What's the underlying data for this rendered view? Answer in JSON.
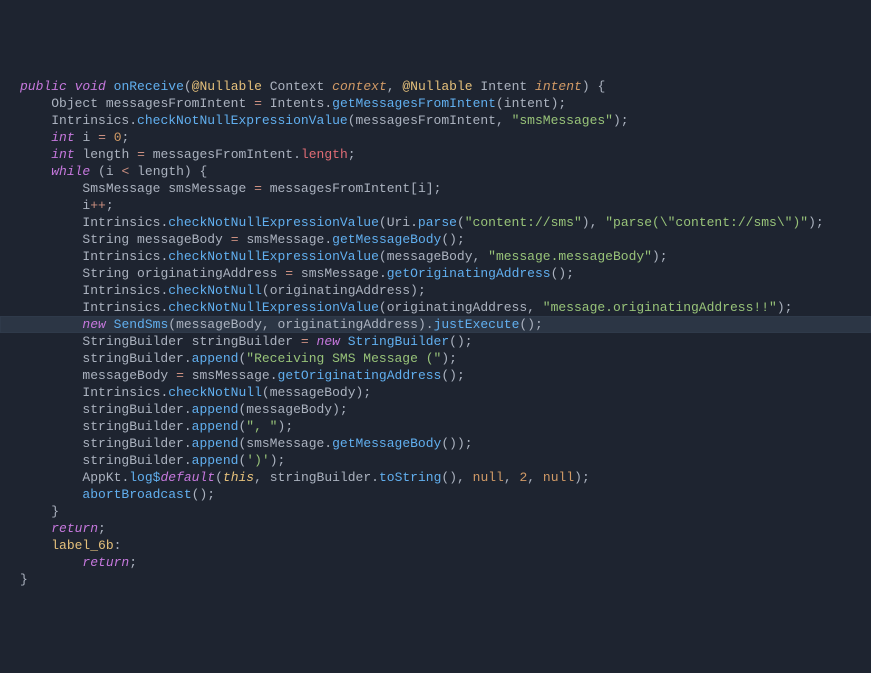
{
  "code": {
    "kw_public": "public",
    "kw_void": "void",
    "fn_onReceive": "onReceive",
    "an_Nullable1": "@Nullable",
    "type_Context": "Context",
    "param_context": "context",
    "an_Nullable2": "@Nullable",
    "type_Intent": "Intent",
    "param_intent": "intent",
    "brace_open": "{",
    "brace_close": "}",
    "paren_open": "(",
    "paren_close": ")",
    "semi": ";",
    "comma": ",",
    "dot": ".",
    "eq": "=",
    "plusplus": "++",
    "lt": "<",
    "lbracket": "[",
    "rbracket": "]",
    "type_Object": "Object",
    "var_messagesFromIntent": "messagesFromIntent",
    "type_Intents": "Intents",
    "fn_getMessagesFromIntent": "getMessagesFromIntent",
    "var_intent": "intent",
    "type_Intrinsics": "Intrinsics",
    "fn_checkNotNullExpressionValue": "checkNotNullExpressionValue",
    "str_smsMessages": "\"smsMessages\"",
    "kw_int": "int",
    "var_i": "i",
    "num_0": "0",
    "var_length": "length",
    "prop_length": "length",
    "kw_while": "while",
    "type_SmsMessage": "SmsMessage",
    "var_smsMessage": "smsMessage",
    "type_Uri": "Uri",
    "fn_parse": "parse",
    "str_contentSms": "\"content://sms\"",
    "str_parseContentSms": "\"parse(\\\"content://sms\\\")\"",
    "type_String": "String",
    "var_messageBody": "messageBody",
    "fn_getMessageBody": "getMessageBody",
    "str_messageMessageBody": "\"message.messageBody\"",
    "var_originatingAddress": "originatingAddress",
    "fn_getOriginatingAddress": "getOriginatingAddress",
    "fn_checkNotNull": "checkNotNull",
    "str_messageOriginatingAddress": "\"message.originatingAddress!!\"",
    "kw_new": "new",
    "type_SendSms": "SendSms",
    "fn_justExecute": "justExecute",
    "type_StringBuilder": "StringBuilder",
    "var_stringBuilder": "stringBuilder",
    "fn_append": "append",
    "str_receivingSmsMessage": "\"Receiving SMS Message (\"",
    "str_commaSpace": "\", \"",
    "str_closeParen": "')'",
    "type_AppKt": "AppKt",
    "fn_logDefault": "log$",
    "fn_default": "default",
    "kw_this": "this",
    "fn_toString": "toString",
    "kw_null": "null",
    "num_2": "2",
    "fn_abortBroadcast": "abortBroadcast",
    "kw_return": "return",
    "label_6b": "label_6b",
    "colon": ":"
  }
}
